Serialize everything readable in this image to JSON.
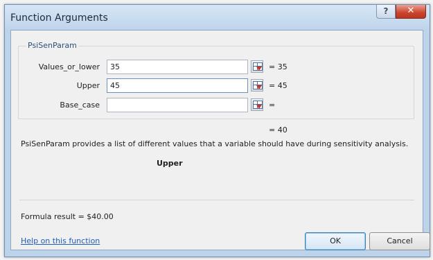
{
  "window": {
    "title": "Function Arguments",
    "help_glyph": "?",
    "close_glyph": "✕"
  },
  "function": {
    "name": "PsiSenParam",
    "arguments": [
      {
        "label": "Values_or_lower",
        "value": "35",
        "evaluated": "=  35"
      },
      {
        "label": "Upper",
        "value": "45",
        "evaluated": "=  45"
      },
      {
        "label": "Base_case",
        "value": "",
        "evaluated": "="
      }
    ],
    "result_preview": "=  40",
    "description": "PsiSenParam provides a list of different values that a variable should have during sensitivity analysis.",
    "current_argument": "Upper"
  },
  "footer": {
    "formula_result": "Formula result =   $40.00",
    "help_link": "Help on this function",
    "ok_label": "OK",
    "cancel_label": "Cancel"
  },
  "colors": {
    "titlebar": "#bed4eb",
    "close_button": "#c9452e",
    "link": "#1f5dbb",
    "group_title": "#2c4e79"
  },
  "icons": {
    "range_selector": "collapse-dialog-icon",
    "help": "help-icon",
    "close": "close-icon"
  }
}
